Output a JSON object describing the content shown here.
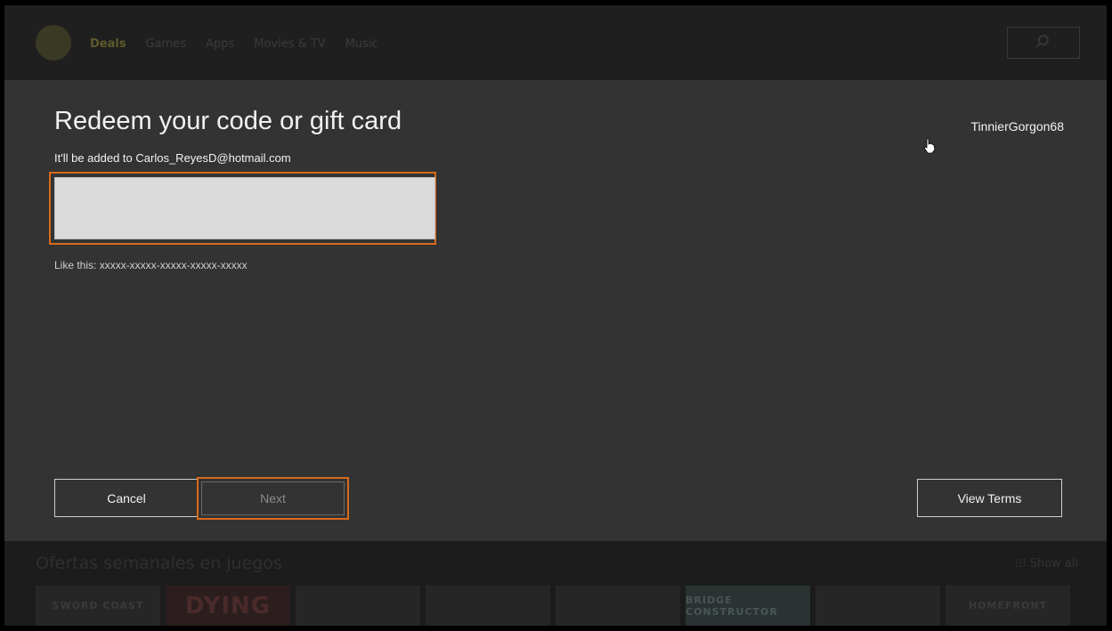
{
  "background": {
    "nav_items": [
      "Deals",
      "Games",
      "Apps",
      "Movies & TV",
      "Music"
    ],
    "section_title": "Ofertas semanales en juegos",
    "show_all": "Show all",
    "tiles": [
      "SWORD COAST",
      "DYING",
      "",
      "",
      "",
      "BRIDGE CONSTRUCTOR",
      "",
      "HOMEFRONT"
    ]
  },
  "dialog": {
    "title": "Redeem your code or gift card",
    "subtitle": "It'll be added to Carlos_ReyesD@hotmail.com",
    "code_input_value": "",
    "hint": "Like this: xxxxx-xxxxx-xxxxx-xxxxx-xxxxx",
    "gamertag": "TinnierGorgon68",
    "buttons": {
      "cancel": "Cancel",
      "next": "Next",
      "view_terms": "View Terms"
    }
  },
  "colors": {
    "focus_accent": "#d86a1c",
    "dialog_bg": "#333333"
  }
}
